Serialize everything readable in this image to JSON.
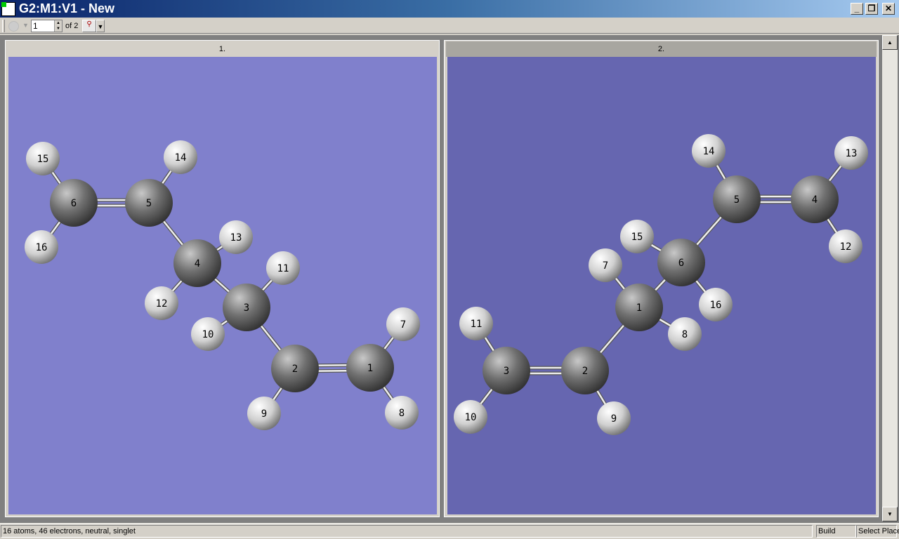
{
  "window": {
    "title": "G2:M1:V1 - New",
    "minimize": "_",
    "restore": "❐",
    "close": "✕"
  },
  "toolbar": {
    "page_value": "1",
    "of_label": "of 2"
  },
  "panes": [
    {
      "label": "1.",
      "background": "#8080cc",
      "atoms": [
        {
          "n": "1",
          "el": "C"
        },
        {
          "n": "2",
          "el": "C"
        },
        {
          "n": "3",
          "el": "C"
        },
        {
          "n": "4",
          "el": "C"
        },
        {
          "n": "5",
          "el": "C"
        },
        {
          "n": "6",
          "el": "C"
        },
        {
          "n": "7",
          "el": "H"
        },
        {
          "n": "8",
          "el": "H"
        },
        {
          "n": "9",
          "el": "H"
        },
        {
          "n": "10",
          "el": "H"
        },
        {
          "n": "11",
          "el": "H"
        },
        {
          "n": "12",
          "el": "H"
        },
        {
          "n": "13",
          "el": "H"
        },
        {
          "n": "14",
          "el": "H"
        },
        {
          "n": "15",
          "el": "H"
        },
        {
          "n": "16",
          "el": "H"
        }
      ],
      "bonds": [
        [
          "6",
          "5",
          2
        ],
        [
          "5",
          "4",
          1
        ],
        [
          "4",
          "3",
          1
        ],
        [
          "3",
          "2",
          1
        ],
        [
          "2",
          "1",
          2
        ],
        [
          "6",
          "15",
          1
        ],
        [
          "6",
          "16",
          1
        ],
        [
          "5",
          "14",
          1
        ],
        [
          "4",
          "13",
          1
        ],
        [
          "4",
          "12",
          1
        ],
        [
          "3",
          "11",
          1
        ],
        [
          "3",
          "10",
          1
        ],
        [
          "1",
          "7",
          1
        ],
        [
          "1",
          "8",
          1
        ],
        [
          "2",
          "9",
          1
        ]
      ]
    },
    {
      "label": "2.",
      "background": "#6666b0",
      "atoms": [
        {
          "n": "1",
          "el": "C"
        },
        {
          "n": "2",
          "el": "C"
        },
        {
          "n": "3",
          "el": "C"
        },
        {
          "n": "4",
          "el": "C"
        },
        {
          "n": "5",
          "el": "C"
        },
        {
          "n": "6",
          "el": "C"
        },
        {
          "n": "7",
          "el": "H"
        },
        {
          "n": "8",
          "el": "H"
        },
        {
          "n": "9",
          "el": "H"
        },
        {
          "n": "10",
          "el": "H"
        },
        {
          "n": "11",
          "el": "H"
        },
        {
          "n": "12",
          "el": "H"
        },
        {
          "n": "13",
          "el": "H"
        },
        {
          "n": "14",
          "el": "H"
        },
        {
          "n": "15",
          "el": "H"
        },
        {
          "n": "16",
          "el": "H"
        }
      ],
      "bonds": [
        [
          "5",
          "4",
          2
        ],
        [
          "5",
          "14",
          1
        ],
        [
          "4",
          "13",
          1
        ],
        [
          "4",
          "12",
          1
        ],
        [
          "5",
          "6",
          1
        ],
        [
          "6",
          "15",
          1
        ],
        [
          "6",
          "16",
          1
        ],
        [
          "6",
          "1",
          1
        ],
        [
          "1",
          "7",
          1
        ],
        [
          "1",
          "8",
          1
        ],
        [
          "1",
          "2",
          1
        ],
        [
          "2",
          "3",
          2
        ],
        [
          "3",
          "11",
          1
        ],
        [
          "3",
          "10",
          1
        ],
        [
          "2",
          "9",
          1
        ]
      ]
    }
  ],
  "status": {
    "info": "16 atoms, 46 electrons, neutral, singlet",
    "mode": "Build",
    "action": "Select Placement"
  }
}
